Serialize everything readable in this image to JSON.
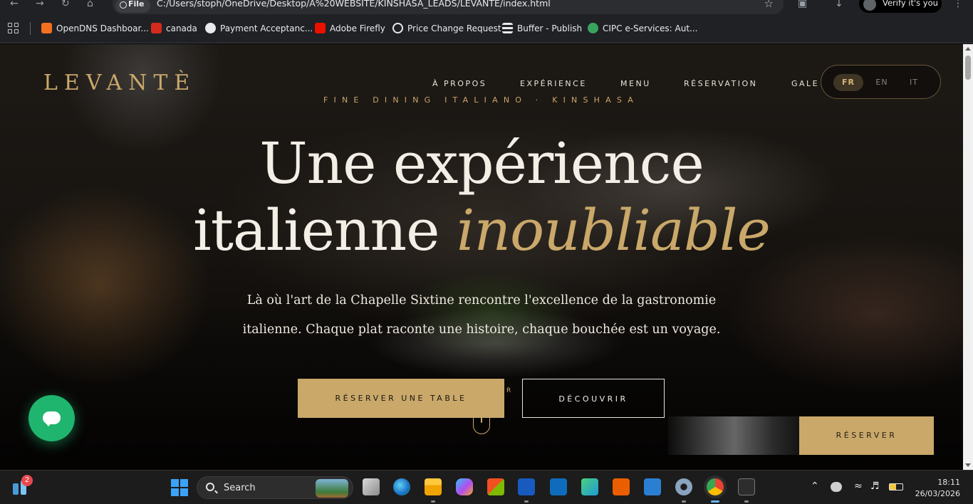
{
  "browser": {
    "url_chip": "File",
    "url": "C:/Users/stoph/OneDrive/Desktop/A%20WEBSITE/KINSHASA_LEADS/LEVANTE/index.html",
    "profile_label": "Verify it's you"
  },
  "bookmarks": [
    {
      "label": "OpenDNS Dashboar...",
      "color": "#f37021"
    },
    {
      "label": "canada",
      "color": "#d52b1e"
    },
    {
      "label": "Payment Acceptanc...",
      "color": "#e8eaed"
    },
    {
      "label": "Adobe Firefly",
      "color": "#eb1000"
    },
    {
      "label": "Price Change Request",
      "color": "#e8eaed"
    },
    {
      "label": "Buffer - Publish",
      "color": "#e8eaed"
    },
    {
      "label": "CIPC e-Services: Aut...",
      "color": "#3aa35f"
    }
  ],
  "site": {
    "logo": "LEVANTÈ",
    "tagline": "FINE DINING ITALIANO · KINSHASA",
    "nav": [
      "À PROPOS",
      "EXPÉRIENCE",
      "MENU",
      "RÉSERVATION",
      "GALE"
    ],
    "languages": [
      {
        "code": "FR",
        "active": true
      },
      {
        "code": "EN",
        "active": false
      },
      {
        "code": "IT",
        "active": false
      }
    ],
    "hero": {
      "line1": "Une expérience",
      "line2_plain": "italienne ",
      "line2_accent": "inoubliable",
      "lead_line1": "Là où l'art de la Chapelle Sixtine rencontre l'excellence de la gastronomie",
      "lead_line2": "italienne. Chaque plat raconte une histoire, chaque bouchée est un voyage."
    },
    "cta_primary": "RÉSERVER UNE TABLE",
    "cta_secondary": "DÉCOUVRIR",
    "ghost_letter": "R",
    "sticky_cta": "RÉSERVER",
    "accent_color": "#c9a86a"
  },
  "taskbar": {
    "widget_badge": "2",
    "search_placeholder": "Search",
    "time": "18:11",
    "date": "26/03/2026"
  }
}
